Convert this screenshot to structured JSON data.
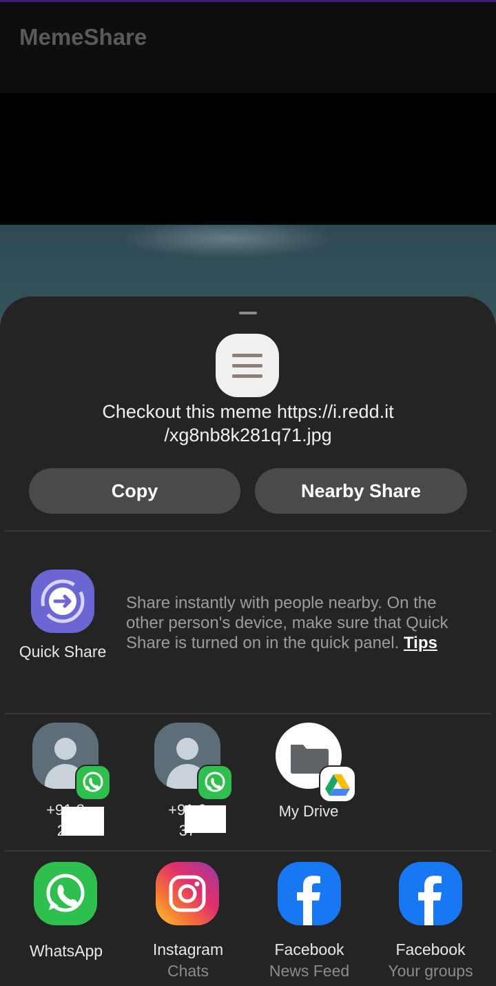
{
  "app_bar": {
    "title": "MemeShare"
  },
  "share_sheet": {
    "shared_text_line1": "Checkout this meme https://i.redd.it",
    "shared_text_line2": "/xg8nb8k281q71.jpg",
    "buttons": {
      "copy": "Copy",
      "nearby_share": "Nearby Share"
    },
    "quick_share": {
      "label": "Quick Share",
      "description": "Share instantly with people nearby. On the other person's device, make sure that Quick Share is turned on in the quick panel.",
      "tips_link": "Tips"
    },
    "direct_targets": [
      {
        "line1": "+91 8",
        "line2": "29"
      },
      {
        "line1": "+91 9",
        "line2": "37"
      },
      {
        "label": "My Drive"
      }
    ],
    "apps": [
      {
        "name": "WhatsApp",
        "sub": ""
      },
      {
        "name": "Instagram",
        "sub": "Chats"
      },
      {
        "name": "Facebook",
        "sub": "News Feed"
      },
      {
        "name": "Facebook",
        "sub": "Your groups"
      }
    ]
  },
  "colors": {
    "sheet_bg": "#242424",
    "button_bg": "#4a4a4a",
    "quick_share_accent": "#6b66d3",
    "whatsapp_green": "#2fbf4e",
    "facebook_blue": "#1877f2"
  },
  "icons": {
    "preview": "text-document-icon",
    "quick_share": "quick-share-icon",
    "contact": "person-icon",
    "contact_badge": "whatsapp-icon",
    "drive": "folder-icon",
    "drive_badge": "google-drive-icon",
    "apps": [
      "whatsapp-icon",
      "instagram-icon",
      "facebook-icon",
      "facebook-icon"
    ]
  }
}
